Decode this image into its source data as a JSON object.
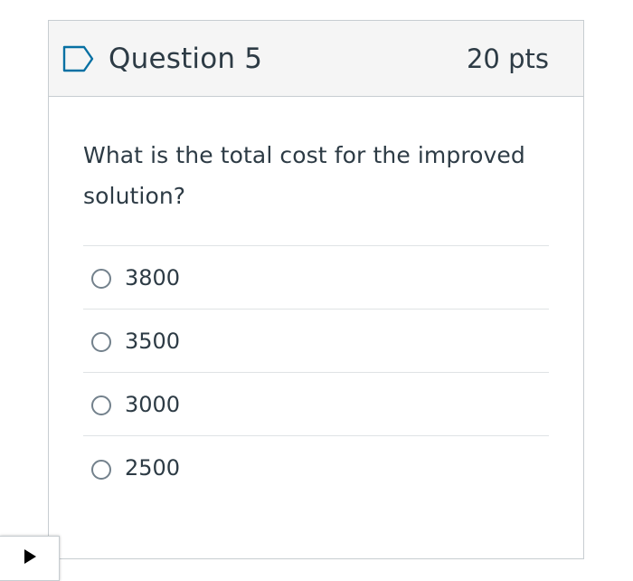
{
  "question": {
    "title": "Question 5",
    "points": "20 pts",
    "text": "What is the total cost for the improved solution?",
    "flag_icon": "bookmark-flag-outline",
    "answers": [
      {
        "label": "3800",
        "selected": false
      },
      {
        "label": "3500",
        "selected": false
      },
      {
        "label": "3000",
        "selected": false
      },
      {
        "label": "2500",
        "selected": false
      }
    ]
  },
  "sidebar_toggle": {
    "icon": "play-triangle-icon"
  },
  "colors": {
    "header_bg": "#f5f5f5",
    "border": "#c7cdd1",
    "text": "#2d3b45",
    "flag": "#0770a3"
  }
}
